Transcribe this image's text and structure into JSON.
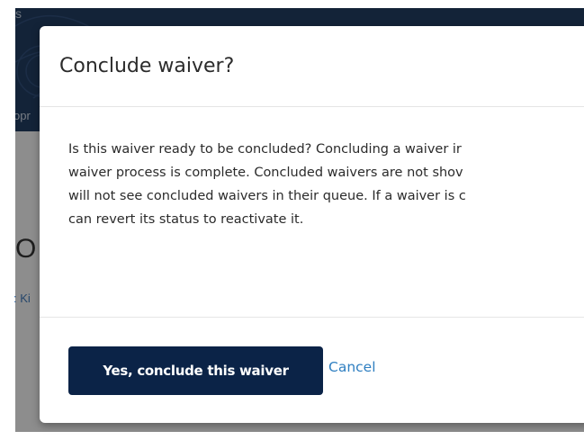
{
  "background": {
    "brand_text": "s",
    "nav_text": "opr",
    "page_title": "O",
    "meta_text": ": Ki"
  },
  "modal": {
    "title": "Conclude waiver?",
    "body_lines": [
      "Is this waiver ready to be concluded? Concluding a waiver ir",
      "waiver process is complete. Concluded waivers are not shov",
      "will not see concluded waivers in their queue. If a waiver is c",
      "can revert its status to reactivate it."
    ],
    "confirm_label": "Yes, conclude this waiver",
    "cancel_label": "Cancel"
  },
  "colors": {
    "header_navy": "#0a2a52",
    "primary_button": "#0b2347",
    "link_blue": "#2f7fc1",
    "overlay": "rgba(30,30,30,0.48)"
  }
}
